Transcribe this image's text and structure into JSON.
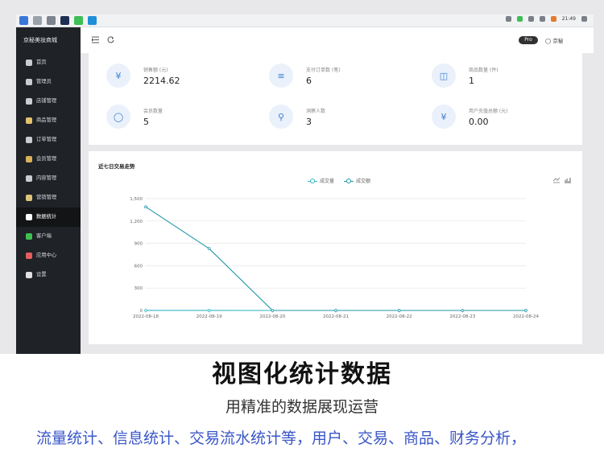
{
  "taskbar": {
    "time": "21:49"
  },
  "sidebar": {
    "brand": "京秘美妆商城",
    "items": [
      {
        "label": "首页",
        "icon": "home-icon",
        "color": "#c9ccd1"
      },
      {
        "label": "管理员",
        "icon": "user-icon",
        "color": "#c9ccd1"
      },
      {
        "label": "店铺管理",
        "icon": "store-icon",
        "color": "#c9ccd1"
      },
      {
        "label": "商品管理",
        "icon": "basket-icon",
        "color": "#e3c26b"
      },
      {
        "label": "订单管理",
        "icon": "order-icon",
        "color": "#c9ccd1"
      },
      {
        "label": "会员管理",
        "icon": "member-icon",
        "color": "#d9b259"
      },
      {
        "label": "内容管理",
        "icon": "content-icon",
        "color": "#c9ccd1"
      },
      {
        "label": "营销管理",
        "icon": "marketing-icon",
        "color": "#e0c27a"
      },
      {
        "label": "数据统计",
        "icon": "chart-icon",
        "color": "#ffffff"
      },
      {
        "label": "客户端",
        "icon": "client-icon",
        "color": "#3fbf4f"
      },
      {
        "label": "应用中心",
        "icon": "apps-icon",
        "color": "#e35d5d"
      },
      {
        "label": "设置",
        "icon": "settings-icon",
        "color": "#e0e0e0"
      }
    ],
    "active_index": 8
  },
  "topbar": {
    "pro_badge": "Pro",
    "username": "京秘"
  },
  "stats": [
    {
      "label": "销售额 (元)",
      "value": "2214.62",
      "icon": "yen-icon"
    },
    {
      "label": "支付订单数 (笔)",
      "value": "6",
      "icon": "document-icon"
    },
    {
      "label": "商品数量 (件)",
      "value": "1",
      "icon": "bag-icon"
    },
    {
      "label": "会员数量",
      "value": "5",
      "icon": "person-icon"
    },
    {
      "label": "洞察人数",
      "value": "3",
      "icon": "person-search-icon"
    },
    {
      "label": "用户充值总额 (元)",
      "value": "0.00",
      "icon": "yen-circle-icon"
    }
  ],
  "chart_title": "近七日交易走势",
  "chart_data": {
    "type": "line",
    "title": "近七日交易走势",
    "categories": [
      "2022-08-18",
      "2022-08-19",
      "2022-08-20",
      "2022-08-21",
      "2022-08-22",
      "2022-08-23",
      "2022-08-24"
    ],
    "series": [
      {
        "name": "成交量",
        "values": [
          1,
          1,
          0,
          0,
          0,
          0,
          0
        ],
        "color": "#2fb6c4"
      },
      {
        "name": "成交额",
        "values": [
          1390,
          830,
          0,
          0,
          0,
          0,
          0
        ],
        "color": "#1f97aa"
      }
    ],
    "yticks": [
      "0",
      "300",
      "600",
      "900",
      "1,200",
      "1,500"
    ],
    "ylim": [
      0,
      1500
    ],
    "grid": true,
    "legend": "top-center"
  },
  "captions": {
    "headline": "视图化统计数据",
    "subline": "用精准的数据展现运营",
    "detail": "流量统计、信息统计、交易流水统计等，用户、交易、商品、财务分析，"
  }
}
